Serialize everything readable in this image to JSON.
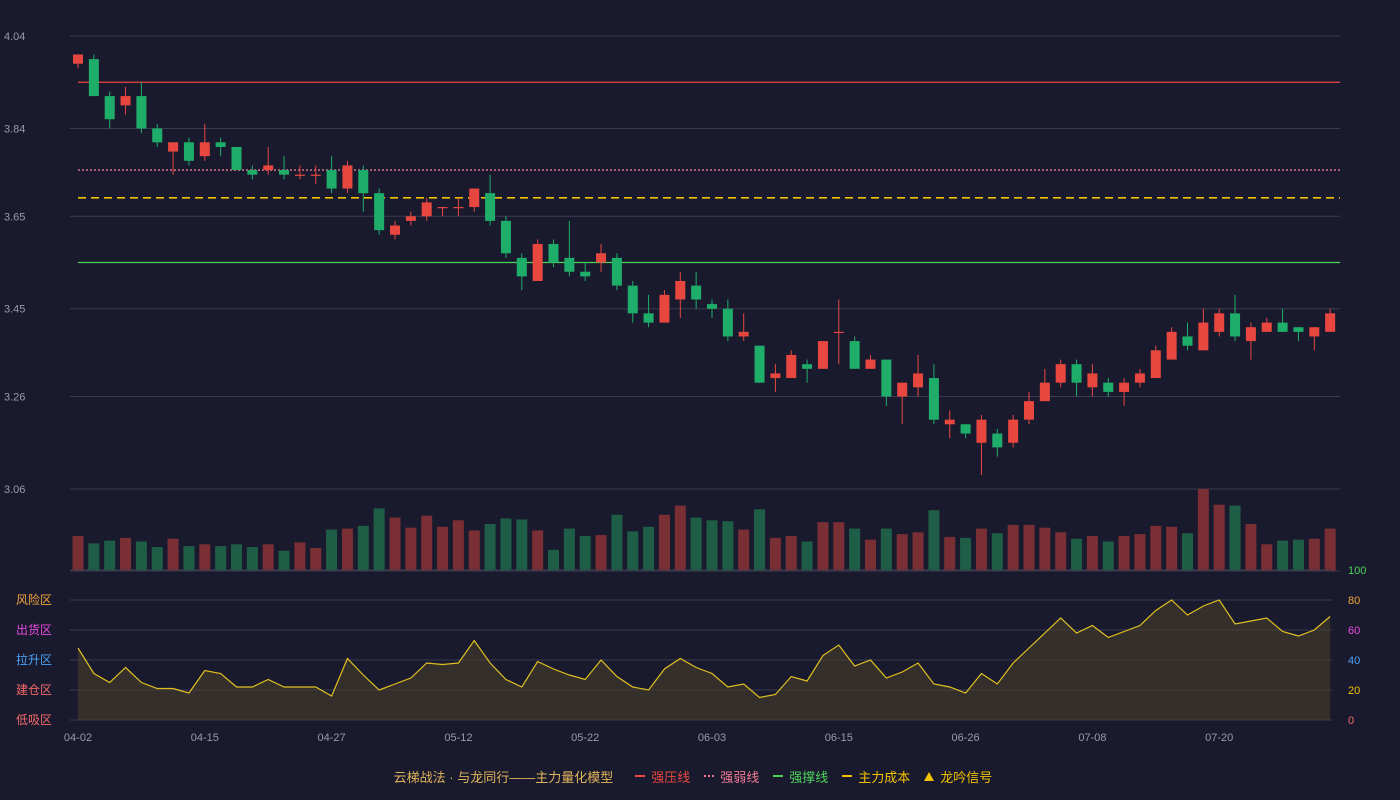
{
  "chart_data": [
    {
      "type": "candlestick",
      "ylim": [
        2.95,
        4.07
      ],
      "y_ticks": [
        "4.04",
        "3.84",
        "3.65",
        "3.45",
        "3.26",
        "3.06"
      ],
      "x_ticks": [
        "04-02",
        "04-15",
        "04-27",
        "05-12",
        "05-22",
        "06-03",
        "06-15",
        "06-26",
        "07-08",
        "07-20"
      ],
      "levels": {
        "resistance": 3.94,
        "weak": 3.75,
        "cost": 3.69,
        "support": 3.55
      },
      "colors": {
        "up": "#e8473f",
        "down": "#1fae6a",
        "resistance": "#e8473f",
        "weak": "#f07a92",
        "cost": "#f2c200",
        "support": "#4fd45a"
      },
      "candles": [
        [
          3.98,
          4.0,
          3.97,
          3.98
        ],
        [
          3.99,
          3.91,
          3.92,
          4.0
        ],
        [
          3.91,
          3.86,
          3.84,
          3.92
        ],
        [
          3.89,
          3.91,
          3.87,
          3.93
        ],
        [
          3.91,
          3.84,
          3.83,
          3.94
        ],
        [
          3.84,
          3.81,
          3.8,
          3.85
        ],
        [
          3.79,
          3.81,
          3.74,
          3.81
        ],
        [
          3.81,
          3.77,
          3.76,
          3.82
        ],
        [
          3.78,
          3.81,
          3.77,
          3.85
        ],
        [
          3.81,
          3.8,
          3.78,
          3.82
        ],
        [
          3.8,
          3.75,
          3.75,
          3.8
        ],
        [
          3.75,
          3.74,
          3.73,
          3.76
        ],
        [
          3.75,
          3.76,
          3.74,
          3.8
        ],
        [
          3.75,
          3.74,
          3.73,
          3.78
        ],
        [
          3.74,
          3.74,
          3.73,
          3.76
        ],
        [
          3.74,
          3.74,
          3.72,
          3.76
        ],
        [
          3.75,
          3.71,
          3.7,
          3.78
        ],
        [
          3.71,
          3.76,
          3.7,
          3.77
        ],
        [
          3.75,
          3.7,
          3.66,
          3.76
        ],
        [
          3.7,
          3.62,
          3.61,
          3.71
        ],
        [
          3.61,
          3.63,
          3.6,
          3.64
        ],
        [
          3.64,
          3.65,
          3.63,
          3.66
        ],
        [
          3.65,
          3.68,
          3.64,
          3.69
        ],
        [
          3.67,
          3.67,
          3.65,
          3.67
        ],
        [
          3.67,
          3.67,
          3.65,
          3.69
        ],
        [
          3.67,
          3.71,
          3.66,
          3.71
        ],
        [
          3.7,
          3.64,
          3.63,
          3.74
        ],
        [
          3.64,
          3.57,
          3.56,
          3.65
        ],
        [
          3.56,
          3.52,
          3.49,
          3.57
        ],
        [
          3.51,
          3.59,
          3.51,
          3.6
        ],
        [
          3.59,
          3.55,
          3.54,
          3.6
        ],
        [
          3.56,
          3.53,
          3.52,
          3.64
        ],
        [
          3.53,
          3.52,
          3.51,
          3.55
        ],
        [
          3.55,
          3.57,
          3.53,
          3.59
        ],
        [
          3.56,
          3.5,
          3.49,
          3.57
        ],
        [
          3.5,
          3.44,
          3.42,
          3.51
        ],
        [
          3.44,
          3.42,
          3.41,
          3.48
        ],
        [
          3.42,
          3.48,
          3.42,
          3.49
        ],
        [
          3.47,
          3.51,
          3.43,
          3.53
        ],
        [
          3.5,
          3.47,
          3.45,
          3.53
        ],
        [
          3.46,
          3.45,
          3.43,
          3.47
        ],
        [
          3.45,
          3.39,
          3.38,
          3.47
        ],
        [
          3.39,
          3.4,
          3.38,
          3.44
        ],
        [
          3.37,
          3.29,
          3.29,
          3.37
        ],
        [
          3.3,
          3.31,
          3.27,
          3.33
        ],
        [
          3.3,
          3.35,
          3.3,
          3.36
        ],
        [
          3.33,
          3.32,
          3.29,
          3.34
        ],
        [
          3.32,
          3.38,
          3.32,
          3.38
        ],
        [
          3.4,
          3.4,
          3.33,
          3.47
        ],
        [
          3.38,
          3.32,
          3.32,
          3.39
        ],
        [
          3.32,
          3.34,
          3.32,
          3.35
        ],
        [
          3.34,
          3.26,
          3.24,
          3.34
        ],
        [
          3.26,
          3.29,
          3.2,
          3.29
        ],
        [
          3.28,
          3.31,
          3.26,
          3.35
        ],
        [
          3.3,
          3.21,
          3.2,
          3.33
        ],
        [
          3.2,
          3.21,
          3.17,
          3.23
        ],
        [
          3.2,
          3.18,
          3.17,
          3.2
        ],
        [
          3.16,
          3.21,
          3.09,
          3.22
        ],
        [
          3.18,
          3.15,
          3.13,
          3.19
        ],
        [
          3.16,
          3.21,
          3.15,
          3.22
        ],
        [
          3.21,
          3.25,
          3.2,
          3.27
        ],
        [
          3.25,
          3.29,
          3.25,
          3.32
        ],
        [
          3.29,
          3.33,
          3.28,
          3.34
        ],
        [
          3.33,
          3.29,
          3.26,
          3.34
        ],
        [
          3.28,
          3.31,
          3.26,
          3.33
        ],
        [
          3.29,
          3.27,
          3.26,
          3.3
        ],
        [
          3.27,
          3.29,
          3.24,
          3.3
        ],
        [
          3.29,
          3.31,
          3.28,
          3.32
        ],
        [
          3.3,
          3.36,
          3.3,
          3.37
        ],
        [
          3.34,
          3.4,
          3.34,
          3.41
        ],
        [
          3.39,
          3.37,
          3.36,
          3.42
        ],
        [
          3.36,
          3.42,
          3.36,
          3.45
        ],
        [
          3.4,
          3.44,
          3.39,
          3.45
        ],
        [
          3.44,
          3.39,
          3.38,
          3.48
        ],
        [
          3.38,
          3.41,
          3.34,
          3.42
        ],
        [
          3.4,
          3.42,
          3.4,
          3.43
        ],
        [
          3.42,
          3.4,
          3.4,
          3.45
        ],
        [
          3.41,
          3.4,
          3.38,
          3.41
        ],
        [
          3.39,
          3.41,
          3.36,
          3.41
        ],
        [
          3.4,
          3.44,
          3.4,
          3.45
        ]
      ],
      "volumes": [
        38,
        30,
        33,
        36,
        32,
        26,
        35,
        27,
        29,
        27,
        29,
        26,
        29,
        22,
        31,
        25,
        45,
        46,
        49,
        68,
        58,
        47,
        60,
        48,
        55,
        44,
        51,
        57,
        56,
        44,
        23,
        46,
        38,
        39,
        61,
        43,
        48,
        61,
        71,
        58,
        55,
        54,
        45,
        67,
        36,
        38,
        32,
        53,
        53,
        46,
        34,
        46,
        40,
        42,
        66,
        37,
        36,
        46,
        41,
        50,
        50,
        47,
        42,
        35,
        38,
        32,
        38,
        40,
        49,
        48,
        41,
        89,
        72,
        71,
        51,
        29,
        33,
        34,
        35,
        46
      ]
    },
    {
      "type": "area",
      "ylim": [
        0,
        100
      ],
      "y_ticks": [
        "100",
        "80",
        "60",
        "40",
        "20",
        "0"
      ],
      "zones": [
        "风险区",
        "出货区",
        "拉升区",
        "建仓区",
        "低吸区"
      ],
      "zone_colors": [
        "#f2a63a",
        "#e84ae0",
        "#4aa3f5",
        "#f56a6a",
        "#f56a6a"
      ],
      "tick_colors": [
        "#4fd45a",
        "#f2a63a",
        "#e84ae0",
        "#4aa3f5",
        "#f2c200",
        "#f56a6a"
      ],
      "values": [
        48,
        31,
        25,
        35,
        25,
        21,
        21,
        18,
        33,
        31,
        22,
        22,
        27,
        22,
        22,
        22,
        16,
        41,
        30,
        20,
        24,
        28,
        38,
        37,
        38,
        53,
        38,
        27,
        22,
        39,
        34,
        30,
        27,
        40,
        29,
        22,
        20,
        34,
        41,
        35,
        31,
        22,
        24,
        15,
        17,
        29,
        26,
        43,
        50,
        36,
        40,
        28,
        32,
        38,
        24,
        22,
        18,
        31,
        24,
        38,
        48,
        58,
        68,
        58,
        63,
        55,
        59,
        63,
        73,
        80,
        70,
        76,
        80,
        64,
        66,
        68,
        59,
        56,
        60,
        69
      ]
    }
  ],
  "legend": {
    "title": "云梯战法 · 与龙同行——主力量化模型",
    "items": [
      {
        "label": "强压线",
        "style": "solid",
        "color": "#e8473f"
      },
      {
        "label": "强弱线",
        "style": "dotted",
        "color": "#f07a92"
      },
      {
        "label": "强撑线",
        "style": "solid",
        "color": "#4fd45a"
      },
      {
        "label": "主力成本",
        "style": "dashed",
        "color": "#f2c200"
      },
      {
        "label": "龙吟信号",
        "style": "triangle",
        "color": "#f2c200"
      }
    ]
  }
}
